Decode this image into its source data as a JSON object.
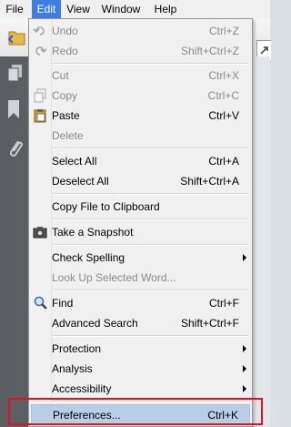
{
  "menubar": [
    "File",
    "Edit",
    "View",
    "Window",
    "Help"
  ],
  "menu": {
    "undo": {
      "label": "Undo",
      "shortcut": "Ctrl+Z"
    },
    "redo": {
      "label": "Redo",
      "shortcut": "Shift+Ctrl+Z"
    },
    "cut": {
      "label": "Cut",
      "shortcut": "Ctrl+X"
    },
    "copy": {
      "label": "Copy",
      "shortcut": "Ctrl+C"
    },
    "paste": {
      "label": "Paste",
      "shortcut": "Ctrl+V"
    },
    "delete": {
      "label": "Delete"
    },
    "select_all": {
      "label": "Select All",
      "shortcut": "Ctrl+A"
    },
    "deselect_all": {
      "label": "Deselect All",
      "shortcut": "Shift+Ctrl+A"
    },
    "copy_file": {
      "label": "Copy File to Clipboard"
    },
    "snapshot": {
      "label": "Take a Snapshot"
    },
    "check_spelling": {
      "label": "Check Spelling"
    },
    "look_up": {
      "label": "Look Up Selected Word..."
    },
    "find": {
      "label": "Find",
      "shortcut": "Ctrl+F"
    },
    "advanced_search": {
      "label": "Advanced Search",
      "shortcut": "Shift+Ctrl+F"
    },
    "protection": {
      "label": "Protection"
    },
    "analysis": {
      "label": "Analysis"
    },
    "accessibility": {
      "label": "Accessibility"
    },
    "preferences": {
      "label": "Preferences...",
      "shortcut": "Ctrl+K"
    }
  },
  "colors": {
    "highlight": "#b8cde6",
    "menubar_active": "#3d7ee0",
    "annotation_box": "#e8111b"
  }
}
